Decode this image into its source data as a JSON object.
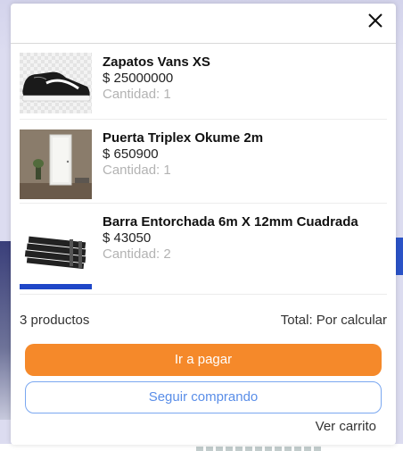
{
  "cart": {
    "items": [
      {
        "name": "Zapatos Vans XS",
        "price": "$ 25000000",
        "quantity": "Cantidad: 1",
        "image": "shoe-image"
      },
      {
        "name": "Puerta Triplex Okume 2m",
        "price": "$ 650900",
        "quantity": "Cantidad: 1",
        "image": "door-image"
      },
      {
        "name": "Barra Entorchada 6m X 12mm Cuadrada",
        "price": "$ 43050",
        "quantity": "Cantidad: 2",
        "image": "steel-bar-image"
      }
    ],
    "product_count": "3 productos",
    "total": "Total: Por calcular",
    "pay_label": "Ir a pagar",
    "continue_label": "Seguir comprando",
    "view_cart_label": "Ver carrito",
    "close_icon": "close-icon"
  },
  "colors": {
    "primary_button": "#f5892a",
    "secondary_border": "#7aa7f0",
    "secondary_text": "#5a8ee8",
    "muted_text": "#b3b3b3"
  }
}
